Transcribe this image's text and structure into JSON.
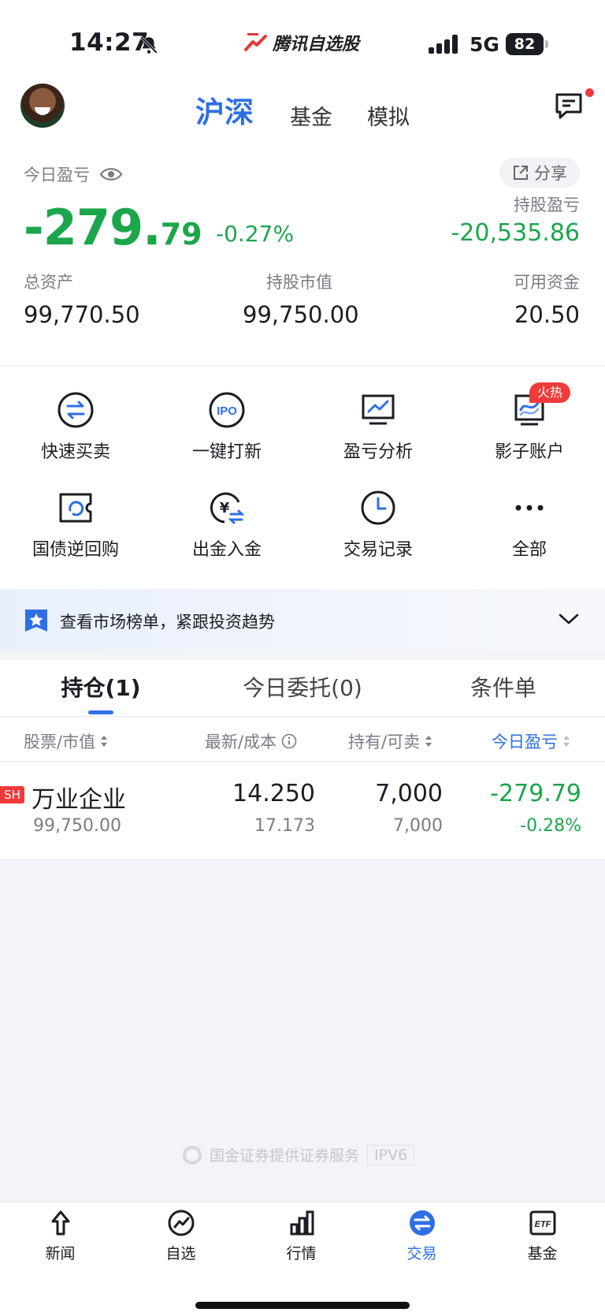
{
  "status": {
    "time": "14:27",
    "network": "5G",
    "battery": "82",
    "brand": "腾讯自选股"
  },
  "header": {
    "tabs": [
      {
        "label": "沪深",
        "active": true
      },
      {
        "label": "基金",
        "active": false
      },
      {
        "label": "模拟",
        "active": false
      }
    ]
  },
  "summary": {
    "today_label": "今日盈亏",
    "share_label": "分享",
    "today_pnl_int": "-279.",
    "today_pnl_dec": "79",
    "today_pct": "-0.27%",
    "holding_pnl_label": "持股盈亏",
    "holding_pnl": "-20,535.86",
    "total_assets_label": "总资产",
    "total_assets": "99,770.50",
    "market_value_label": "持股市值",
    "market_value": "99,750.00",
    "available_label": "可用资金",
    "available": "20.50"
  },
  "actions": [
    {
      "label": "快速买卖",
      "icon": "swap-icon"
    },
    {
      "label": "一键打新",
      "icon": "ipo-icon"
    },
    {
      "label": "盈亏分析",
      "icon": "chart-monitor-icon"
    },
    {
      "label": "影子账户",
      "icon": "shadow-account-icon",
      "badge": "火热"
    },
    {
      "label": "国债逆回购",
      "icon": "repo-icon"
    },
    {
      "label": "出金入金",
      "icon": "yuan-transfer-icon"
    },
    {
      "label": "交易记录",
      "icon": "clock-icon"
    },
    {
      "label": "全部",
      "icon": "more-icon"
    }
  ],
  "banner": {
    "text": "查看市场榜单，紧跟投资趋势"
  },
  "holding_tabs": [
    {
      "label": "持仓(1)",
      "active": true
    },
    {
      "label": "今日委托(0)",
      "active": false
    },
    {
      "label": "条件单",
      "active": false
    }
  ],
  "table": {
    "headers": [
      "股票/市值",
      "最新/成本",
      "持有/可卖",
      "今日盈亏"
    ],
    "rows": [
      {
        "market": "SH",
        "name": "万业企业",
        "market_value": "99,750.00",
        "latest": "14.250",
        "cost": "17.173",
        "held": "7,000",
        "sellable": "7,000",
        "today_pnl": "-279.79",
        "today_pct": "-0.28%"
      }
    ]
  },
  "footer": {
    "service_text": "国金证券提供证券服务",
    "ipv6": "IPV6"
  },
  "bottom_nav": [
    {
      "label": "新闻",
      "icon": "news-icon",
      "active": false
    },
    {
      "label": "自选",
      "icon": "watchlist-icon",
      "active": false
    },
    {
      "label": "行情",
      "icon": "market-icon",
      "active": false
    },
    {
      "label": "交易",
      "icon": "trade-icon",
      "active": true
    },
    {
      "label": "基金",
      "icon": "etf-icon",
      "active": false
    }
  ],
  "colors": {
    "accent": "#2f6fe6",
    "down_green": "#1ca64c",
    "up_red": "#f03b3b"
  }
}
